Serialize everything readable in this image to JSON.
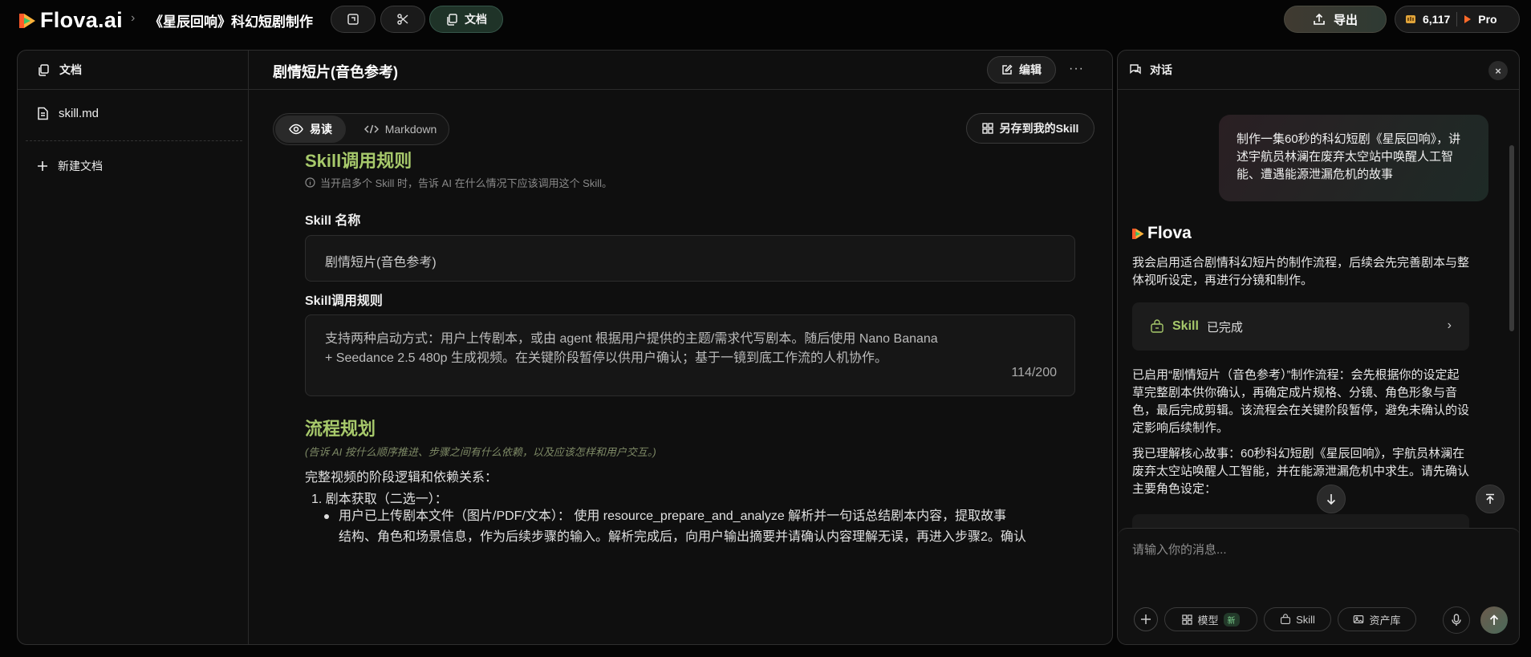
{
  "app": {
    "logo_text": "Flova.ai",
    "project_title": "《星辰回响》科幻短剧制作"
  },
  "toolbar": {
    "docs_label": "文档",
    "export_label": "导出",
    "credits": "6,117",
    "plan": "Pro"
  },
  "sidebar": {
    "header": "文档",
    "file_name": "skill.md",
    "new_doc_label": "新建文档"
  },
  "document": {
    "title": "剧情短片(音色参考)",
    "edit_label": "编辑",
    "more_label": "···",
    "view_read_label": "易读",
    "view_markdown_label": "Markdown",
    "save_skill_label": "另存到我的Skill",
    "section1_title": "Skill调用规则",
    "section1_hint": "当开启多个 Skill 时，告诉 AI 在什么情况下应该调用这个 Skill。",
    "skill_name_label": "Skill 名称",
    "skill_name_value": "剧情短片(音色参考)",
    "rule_label": "Skill调用规则",
    "rule_line1": "支持两种启动方式：用户上传剧本，或由 agent 根据用户提供的主题/需求代写剧本。随后使用 Nano Banana",
    "rule_line2": "+ Seedance 2.5 480p 生成视频。在关键阶段暂停以供用户确认；基于一镜到底工作流的人机协作。",
    "rule_counter": "114/200",
    "section2_title": "流程规划",
    "section2_hint": "(告诉 AI 按什么顺序推进、步骤之间有什么依赖，以及应该怎样和用户交互。)",
    "flow_intro": "完整视频的阶段逻辑和依赖关系：",
    "flow_step1": "1. 剧本获取（二选一）：",
    "flow_bullet1_line1": "用户已上传剧本文件（图片/PDF/文本）：  使用 resource_prepare_and_analyze 解析并一句话总结剧本内容，提取故事",
    "flow_bullet1_line2": "结构、角色和场景信息，作为后续步骤的输入。解析完成后，向用户输出摘要并请确认内容理解无误，再进入步骤2。确认"
  },
  "chat": {
    "header": "对话",
    "close_label": "×",
    "user_message": "制作一集60秒的科幻短剧《星辰回响》，讲述宇航员林澜在废弃太空站中唤醒人工智能、遭遇能源泄漏危机的故事",
    "brand": "Flova",
    "ai_msg1": "我会启用适合剧情科幻短片的制作流程，后续会先完善剧本与整体视听设定，再进行分镜和制作。",
    "skill_card_name": "Skill",
    "skill_card_status": "已完成",
    "ai_msg2": "已启用“剧情短片（音色参考）”制作流程：会先根据你的设定起草完整剧本供你确认，再确定成片规格、分镜、角色形象与音色，最后完成剪辑。该流程会在关键阶段暂停，避免未确认的设定影响后续制作。",
    "ai_msg3": "我已理解核心故事：60秒科幻短剧《星辰回响》，宇航员林澜在废弃太空站唤醒人工智能，并在能源泄漏危机中求生。请先确认主要角色设定：",
    "input_placeholder": "请输入你的消息...",
    "chip_model": "模型",
    "chip_model_badge": "新",
    "chip_skill": "Skill",
    "chip_assets": "资产库"
  }
}
